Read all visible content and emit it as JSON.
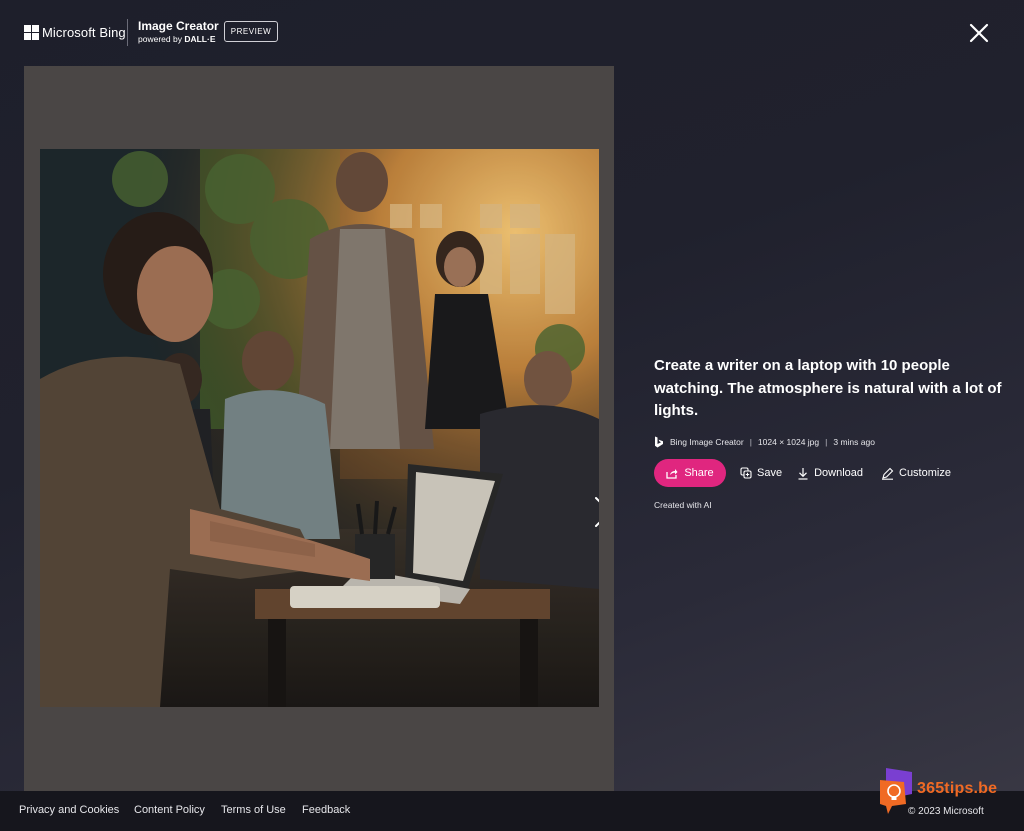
{
  "header": {
    "brand": "Microsoft Bing",
    "app_title": "Image Creator",
    "app_sub_prefix": "powered by",
    "app_sub_engine": "DALL·E",
    "badge": "PREVIEW"
  },
  "image": {
    "alt": "Create a writer on a laptop with 10 people watching. The atmosphere is natural with a lot of lights."
  },
  "details": {
    "prompt": "Create a writer on a laptop with 10 people watching. The atmosphere is natural with a lot of lights.",
    "source": "Bing Image Creator",
    "size": "1024 × 1024 jpg",
    "time": "3 mins ago",
    "separator": "|",
    "created_with": "Created with AI"
  },
  "actions": {
    "share": "Share",
    "save": "Save",
    "download": "Download",
    "customize": "Customize"
  },
  "footer": {
    "privacy": "Privacy and Cookies",
    "content_policy": "Content Policy",
    "terms": "Terms of Use",
    "feedback": "Feedback",
    "copyright": "© 2023 Microsoft"
  },
  "watermark": {
    "text": "365tips.be"
  },
  "colors": {
    "background": "#1e1f2b",
    "share_button": "#e0267f",
    "footer": "#16161d",
    "image_panel": "#4a4645",
    "watermark": "#f06a24"
  },
  "icons": {
    "close": "close-icon",
    "next": "chevron-right-icon",
    "share": "share-icon",
    "save": "collection-icon",
    "download": "download-icon",
    "customize": "edit-icon",
    "source": "bing-b-icon"
  }
}
